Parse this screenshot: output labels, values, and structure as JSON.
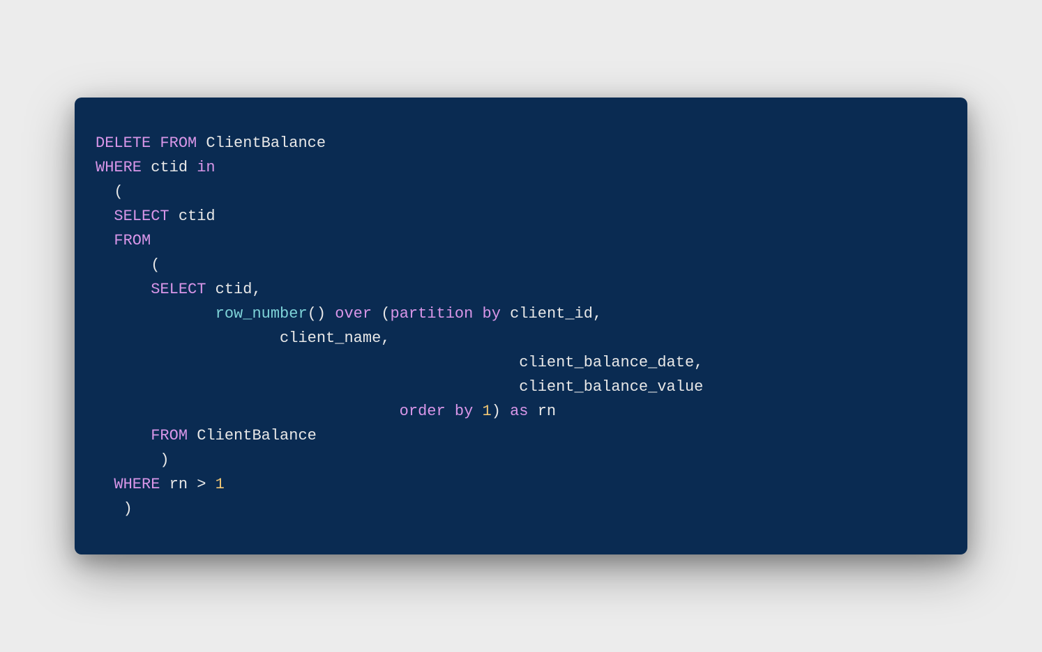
{
  "code": {
    "line1_kw1": "DELETE",
    "line1_kw2": "FROM",
    "line1_plain": " ClientBalance",
    "line2_kw1": "WHERE",
    "line2_plain1": " ctid ",
    "line2_kw2": "in",
    "line3_plain": "  (",
    "line4_indent": "  ",
    "line4_kw": "SELECT",
    "line4_plain": " ctid",
    "line5_indent": "  ",
    "line5_kw": "FROM",
    "line6_plain": "      (",
    "line7_indent": "      ",
    "line7_kw": "SELECT",
    "line7_plain": " ctid,",
    "line8_indent": "             ",
    "line8_fn": "row_number",
    "line8_plain1": "() ",
    "line8_over": "over",
    "line8_plain2": " (",
    "line8_kw": "partition",
    "line8_plain3": " ",
    "line8_by": "by",
    "line8_plain4": " client_id,",
    "line9_plain": "                    client_name,",
    "line10_plain": "                                              client_balance_date,",
    "line11_plain": "                                              client_balance_value",
    "line12_indent": "                                 ",
    "line12_kw1": "order",
    "line12_plain1": " ",
    "line12_kw2": "by",
    "line12_plain2": " ",
    "line12_num": "1",
    "line12_plain3": ") ",
    "line12_as": "as",
    "line12_plain4": " rn",
    "line13_indent": "      ",
    "line13_kw": "FROM",
    "line13_plain": " ClientBalance",
    "line14_plain": "       )",
    "line15_indent": "  ",
    "line15_kw": "WHERE",
    "line15_plain1": " rn ",
    "line15_op": ">",
    "line15_plain2": " ",
    "line15_num": "1",
    "line16_plain": "   )"
  }
}
